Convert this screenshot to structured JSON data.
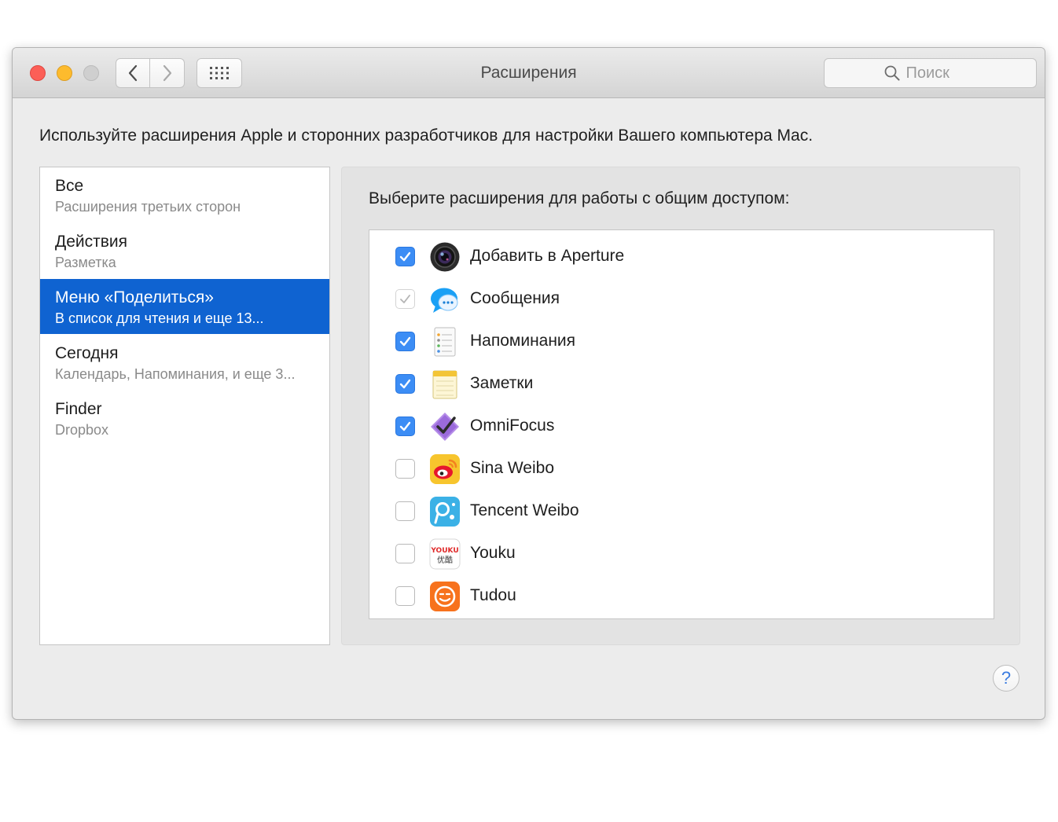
{
  "window": {
    "title": "Расширения"
  },
  "toolbar": {
    "search_placeholder": "Поиск"
  },
  "description": "Используйте расширения Apple и сторонних разработчиков для настройки Вашего компьютера Mac.",
  "sidebar": {
    "items": [
      {
        "title": "Все",
        "subtitle": "Расширения третьих сторон",
        "selected": false
      },
      {
        "title": "Действия",
        "subtitle": "Разметка",
        "selected": false
      },
      {
        "title": "Меню «Поделиться»",
        "subtitle": "В список для чтения и еще 13...",
        "selected": true
      },
      {
        "title": "Сегодня",
        "subtitle": "Календарь, Напоминания, и еще 3...",
        "selected": false
      },
      {
        "title": "Finder",
        "subtitle": "Dropbox",
        "selected": false
      }
    ]
  },
  "panel": {
    "title": "Выберите расширения для работы с общим доступом:",
    "extensions": [
      {
        "name": "Добавить в Aperture",
        "checked": true,
        "disabled": false,
        "icon": "aperture-icon"
      },
      {
        "name": "Сообщения",
        "checked": true,
        "disabled": true,
        "icon": "messages-icon"
      },
      {
        "name": "Напоминания",
        "checked": true,
        "disabled": false,
        "icon": "reminders-icon"
      },
      {
        "name": "Заметки",
        "checked": true,
        "disabled": false,
        "icon": "notes-icon"
      },
      {
        "name": "OmniFocus",
        "checked": true,
        "disabled": false,
        "icon": "omnifocus-icon"
      },
      {
        "name": "Sina Weibo",
        "checked": false,
        "disabled": false,
        "icon": "sina-weibo-icon"
      },
      {
        "name": "Tencent Weibo",
        "checked": false,
        "disabled": false,
        "icon": "tencent-weibo-icon"
      },
      {
        "name": "Youku",
        "checked": false,
        "disabled": false,
        "icon": "youku-icon",
        "icon_text_top": "YOUKU",
        "icon_text_bottom": "优酷"
      },
      {
        "name": "Tudou",
        "checked": false,
        "disabled": false,
        "icon": "tudou-icon"
      }
    ]
  },
  "help_label": "?",
  "colors": {
    "accent": "#3c8df5",
    "selection": "#0f63d1",
    "close": "#fc5f57",
    "minimize": "#fdbb2d"
  }
}
